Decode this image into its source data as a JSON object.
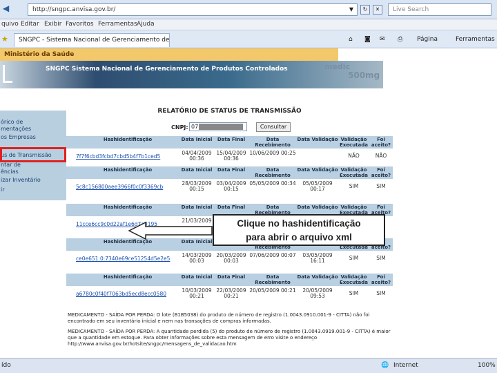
{
  "browser": {
    "url": "http://sngpc.anvisa.gov.br/",
    "search_placeholder": "Live Search",
    "menu": [
      "quivo",
      "Editar",
      "Exibir",
      "Favoritos",
      "Ferramentas",
      "Ajuda"
    ],
    "tab_title": "SNGPC - Sistema Nacional de Gerenciamento de Produ...",
    "page_label": "Página",
    "tools_label": "Ferramentas",
    "status_left": "ído",
    "zone": "Internet",
    "zoom": "100%"
  },
  "site": {
    "ministry": "Ministério da Saúde",
    "banner_title": "SNGPC Sistema Nacional de Gerenciamento de Produtos Controlados",
    "banner_med": "medic",
    "banner_mg": "500mg"
  },
  "sidebar": {
    "items": [
      "órico de",
      "mentações",
      "os Empresas",
      "us de Transmissão",
      "ntar de",
      "ências",
      "izar Inventário",
      "ir"
    ]
  },
  "report": {
    "title": "RELATÓRIO DE STATUS DE TRANSMISSÃO",
    "cnpj_label": "CNPJ:",
    "cnpj_value": "07.",
    "consultar": "Consultar",
    "headers": [
      "Hashidentificação",
      "Data Inicial",
      "Data Final",
      "Data Recebimento",
      "Data Validação",
      "Validação Executada",
      "Foi aceito?"
    ],
    "rows": [
      {
        "hash": "7f7f6cbd3fcbd7cbd5b4f7b1ced5",
        "inicial": "04/04/2009 00:36",
        "final": "15/04/2009 00:36",
        "receb": "10/06/2009 00:25",
        "valid": "",
        "exec": "NÃO",
        "aceito": "NÃO"
      },
      {
        "hash": "5c8c156800aee3966f0c0f3369cb",
        "inicial": "28/03/2009 00:15",
        "final": "03/04/2009 00:15",
        "receb": "05/05/2009 00:34",
        "valid": "05/05/2009 00:17",
        "exec": "SIM",
        "aceito": "SIM"
      },
      {
        "hash": "11cce6cc9c0d22af1e6d7a0195",
        "inicial": "21/03/2009",
        "final": "",
        "receb": "",
        "valid": "",
        "exec": "",
        "aceito": ""
      },
      {
        "hash": "ce0e651:0:7340e69ce51254d5e2e5",
        "inicial": "14/03/2009 00:03",
        "final": "20/03/2009 00:03",
        "receb": "07/06/2009 00:07",
        "valid": "03/05/2009 16:11",
        "exec": "SIM",
        "aceito": "SIM"
      },
      {
        "hash": "a6780c0f40f7063bd5ecd8ecc0580",
        "inicial": "10/03/2009 00:21",
        "final": "22/03/2009 00:21",
        "receb": "20/05/2009 00:21",
        "valid": "20/05/2009 09:53",
        "exec": "SIM",
        "aceito": "SIM"
      }
    ],
    "messages": [
      "MEDICAMENTO - SAÍDA POR PERDA: O lote (B1B5038) do produto de número de registro (1.0043.0910.001-9 - CITTA) não foi encontrado em seu inventário inicial e nem nas transações de compras informadas.",
      "MEDICAMENTO - SAÍDA POR PERDA: A quantidade perdida (5) do produto de número de registro (1.0043.0919.001-9 - CITTA) é maior que a quantidade em estoque. Para obter informações sobre esta mensagem de erro visite o endereço http://www.anvisa.gov.br/hotsite/sngpc/mensagens_de_validacao.htm"
    ]
  },
  "callout": {
    "line1": "Clique no hashidentificação",
    "line2": "para abrir o arquivo xml"
  },
  "colors": {
    "accent": "#b9cfe2",
    "highlight": "#e02020"
  }
}
